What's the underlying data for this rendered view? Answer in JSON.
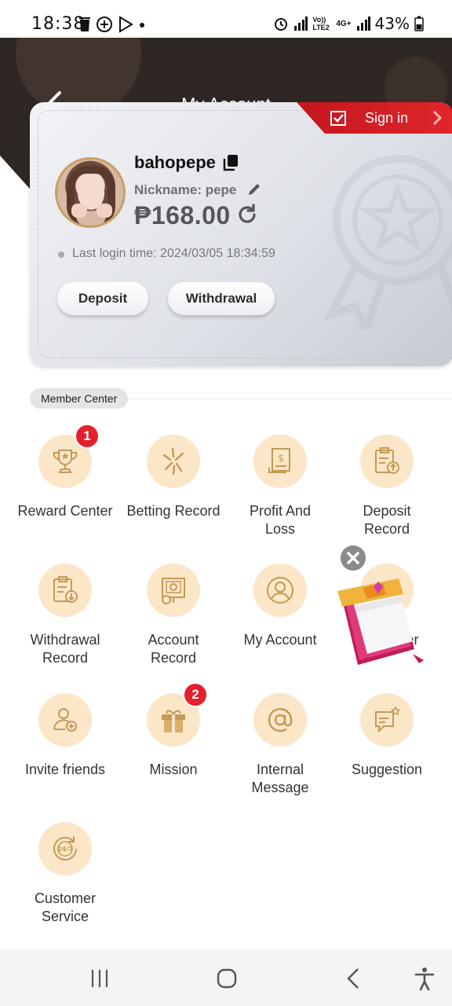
{
  "status_bar": {
    "time": "18:38",
    "battery_pct": "43%",
    "network_label": "4G+",
    "volte_label": "Vo)) LTE2"
  },
  "header": {
    "title": "My Account",
    "back_icon": "chevron-left-icon"
  },
  "account": {
    "sign_in_label": "Sign in",
    "username": "bahopepe",
    "nickname": "Nickname: pepe",
    "balance": "₱168.00",
    "last_login": "Last login time: 2024/03/05 18:34:59",
    "deposit_label": "Deposit",
    "withdrawal_label": "Withdrawal"
  },
  "member_center": {
    "title": "Member Center",
    "items": [
      {
        "label": "Reward Center",
        "icon": "trophy-icon",
        "badge": "1"
      },
      {
        "label": "Betting Record",
        "icon": "sparkle-icon",
        "badge": null
      },
      {
        "label": "Profit And Loss",
        "icon": "document-dollar-icon",
        "badge": null
      },
      {
        "label": "Deposit Record",
        "icon": "clipboard-upload-icon",
        "badge": null
      },
      {
        "label": "Withdrawal Record",
        "icon": "clipboard-download-icon",
        "badge": null
      },
      {
        "label": "Account Record",
        "icon": "chart-board-icon",
        "badge": null
      },
      {
        "label": "My Account",
        "icon": "user-circle-icon",
        "badge": null
      },
      {
        "label": "nter",
        "icon": "hidden-icon",
        "badge": null
      },
      {
        "label": "Invite friends",
        "icon": "user-add-icon",
        "badge": null
      },
      {
        "label": "Mission",
        "icon": "gift-icon",
        "badge": "2"
      },
      {
        "label": "Internal Message",
        "icon": "at-sign-icon",
        "badge": null
      },
      {
        "label": "Suggestion",
        "icon": "comment-star-icon",
        "badge": null
      },
      {
        "label": "Customer Service",
        "icon": "clock-24-7-icon",
        "badge": null
      }
    ]
  },
  "colors": {
    "header_bg": "#2f2724",
    "accent_red": "#e0262b",
    "icon_bg": "#fbe6c8",
    "icon_stroke": "#c49a55"
  }
}
